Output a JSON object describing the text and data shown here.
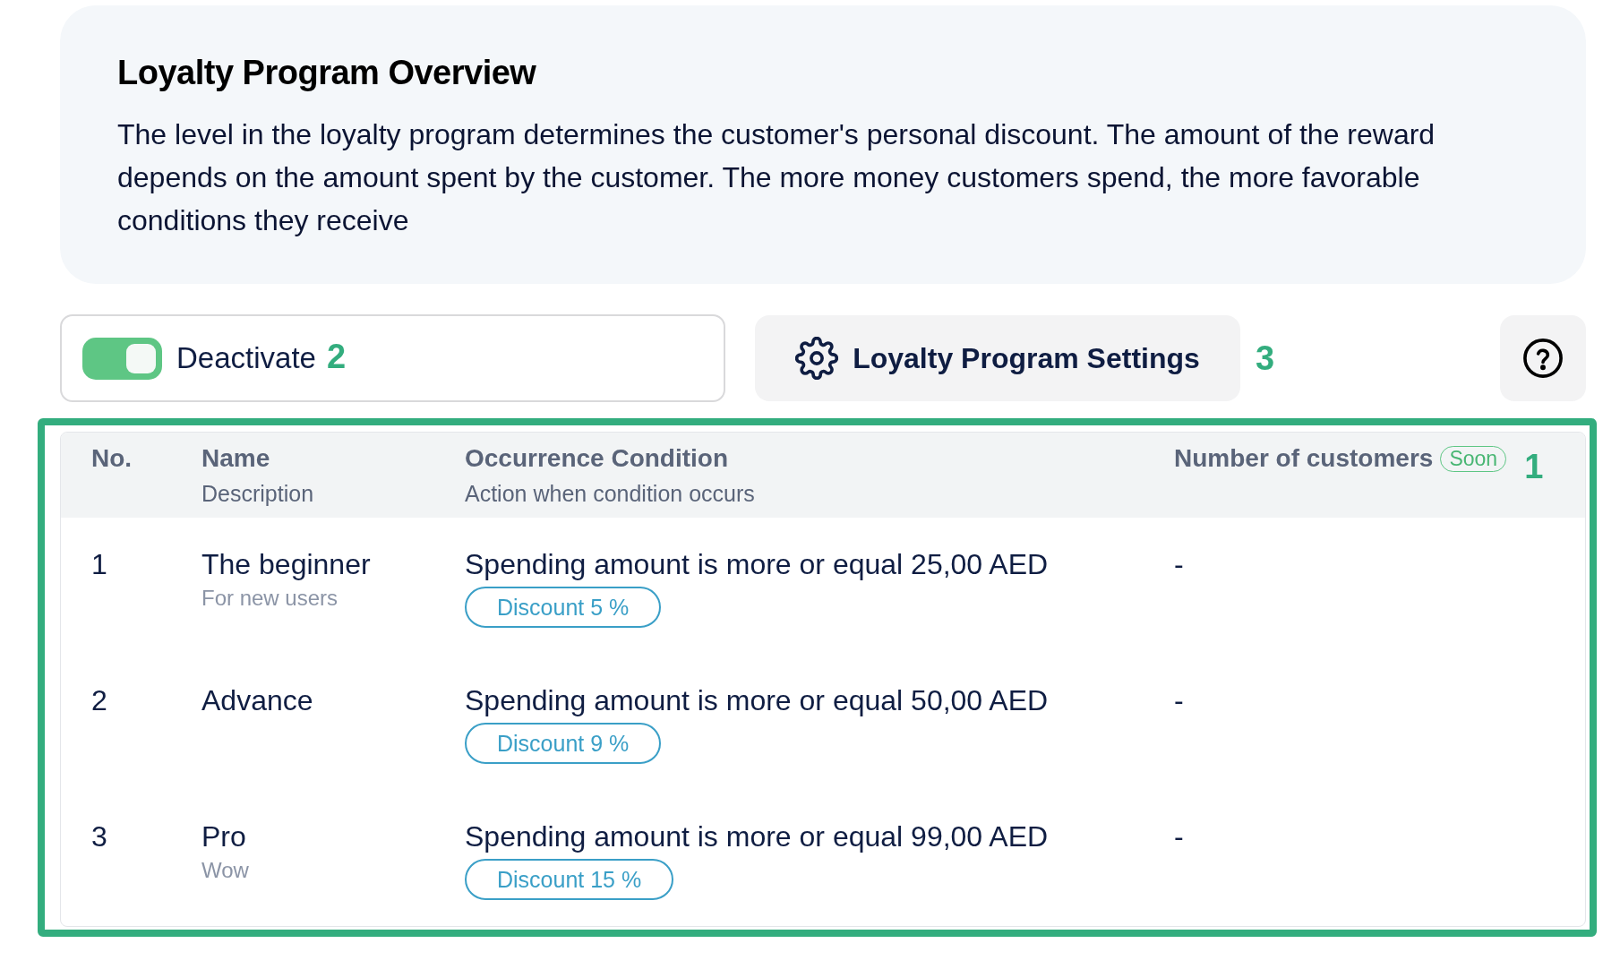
{
  "overview": {
    "title": "Loyalty Program Overview",
    "description": "The level in the loyalty program determines the customer's personal discount. The amount of the reward depends on the amount spent by the customer. The more money customers spend, the more favorable conditions they receive"
  },
  "toolbar": {
    "toggle": {
      "label": "Deactivate",
      "on": true,
      "annotation": "2"
    },
    "settings_button": {
      "label": "Loyalty Program Settings",
      "annotation": "3"
    }
  },
  "table": {
    "highlighted": true,
    "annotation": "1",
    "columns": [
      {
        "title": "No."
      },
      {
        "title": "Name",
        "subtitle": "Description"
      },
      {
        "title": "Occurrence Condition",
        "subtitle": "Action when condition occurs"
      },
      {
        "title": "Number of customers",
        "badge": "Soon"
      }
    ],
    "rows": [
      {
        "no": "1",
        "name": "The beginner",
        "description": "For new users",
        "condition": "Spending amount is more or equal 25,00 AED",
        "action": "Discount 5 %",
        "customers": "-"
      },
      {
        "no": "2",
        "name": "Advance",
        "condition": "Spending amount is more or equal 50,00 AED",
        "action": "Discount 9 %",
        "customers": "-"
      },
      {
        "no": "3",
        "name": "Pro",
        "description": "Wow",
        "condition": "Spending amount is more or equal 99,00 AED",
        "action": "Discount 15 %",
        "customers": "-"
      }
    ]
  }
}
